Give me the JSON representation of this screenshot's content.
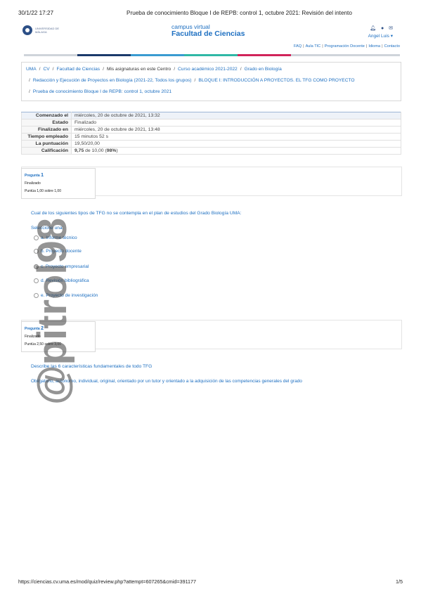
{
  "print_header": {
    "datetime": "30/1/22 17:27",
    "doc_title": "Prueba de conocimiento Bloque I de REPB: control 1, octubre 2021: Revisión del intento"
  },
  "site": {
    "logo_text": "UNIVERSIDAD DE MÁLAGA",
    "campus_line1": "campus virtual",
    "campus_line2": "Facultad de Ciencias",
    "user_name": "Angel Luis",
    "icons": [
      "bell-icon",
      "chat-icon",
      "mail-icon",
      "chevron-down-icon"
    ],
    "top_links": [
      "FAQ",
      "Aula TIC",
      "Programación Docente",
      "Idioma",
      "Contacto"
    ],
    "colorbar": [
      "#cfd4da",
      "#1b3a6b",
      "#3a9bd1",
      "#2fb8a6",
      "#d1245a"
    ]
  },
  "breadcrumb": {
    "line1": [
      "UMA",
      "CV",
      "Facultad de Ciencias",
      "Mis asignaturas en este Centro",
      "Curso académico 2021-2022",
      "Grado en Biología"
    ],
    "line2": [
      "Redacción y Ejecución de Proyectos en Biología (2021-22, Todos los grupos)",
      "BLOQUE I: INTRODUCCIÓN A PROYECTOS. EL TFG COMO PROYECTO"
    ],
    "line3": [
      "Prueba de conocimiento Bloque I de REPB: control 1, octubre 2021"
    ]
  },
  "summary": [
    {
      "key": "Comenzado el",
      "value": "miércoles, 20 de octubre de 2021, 13:32"
    },
    {
      "key": "Estado",
      "value": "Finalizado"
    },
    {
      "key": "Finalizado en",
      "value": "miércoles, 20 de octubre de 2021, 13:48"
    },
    {
      "key": "Tiempo empleado",
      "value": "15 minutos 52 s"
    },
    {
      "key": "La puntuación",
      "value": "19,50/20,00"
    },
    {
      "key": "Calificación",
      "value_pre": "9,75",
      "value_mid": " de 10,00 (",
      "value_pct": "98%",
      "value_post": ")"
    }
  ],
  "questions": [
    {
      "label": "Pregunta",
      "number": "1",
      "status": "Finalizado",
      "score": "Puntúa 1,00 sobre 1,00",
      "text": "Cual de los siguientes tipos de TFG no se contempla en el plan de estudios del Grado Biología UMA:",
      "prompt": "Seleccione una:",
      "options": [
        "a. Informe técnico",
        "b. Proyecto docente",
        "c. Proyecto empresarial",
        "d. Revisión bibliográfica",
        "e. Proyecto de investigación"
      ],
      "selected_index": 2
    },
    {
      "label": "Pregunta",
      "number": "2",
      "status": "Finalizado",
      "score": "Puntúa 2,50 sobre 3,00",
      "text": "Describe las 6 características fundamentales de todo TFG",
      "answer": "Obligatorio, autónomo, individual, original, orientado por un tutor y orientado a la adquisición de las competencias generales del grado"
    }
  ],
  "watermark_text": "@pitrol98",
  "footer": {
    "url": "https://ciencias.cv.uma.es/mod/quiz/review.php?attempt=607265&cmid=391177",
    "page": "1/5"
  }
}
